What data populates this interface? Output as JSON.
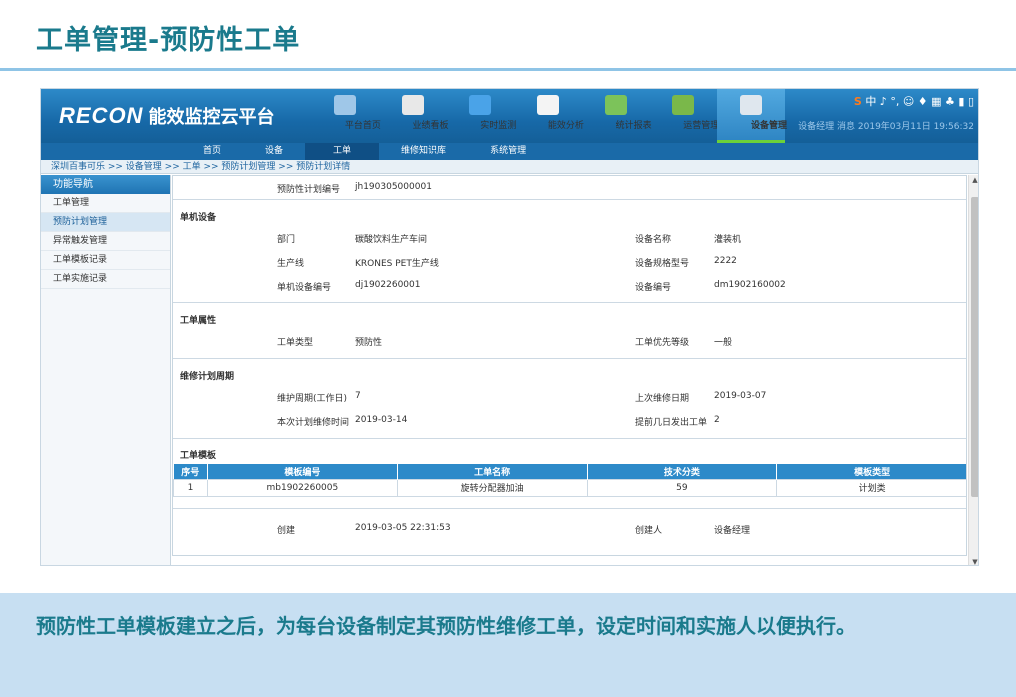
{
  "slide": {
    "title": "工单管理-预防性工单",
    "caption": "预防性工单模板建立之后，为每台设备制定其预防性维修工单，设定时间和实施人以便执行。"
  },
  "app": {
    "brand_logo": "RECON",
    "brand_name": "能效监控云平台",
    "nav": [
      {
        "label": "平台首页",
        "icon": "search-globe-icon",
        "color": "#9fc7e8"
      },
      {
        "label": "业绩看板",
        "icon": "line-chart-icon",
        "color": "#e8e8e8"
      },
      {
        "label": "实时监测",
        "icon": "monitor-icon",
        "color": "#4aa3e8"
      },
      {
        "label": "能效分析",
        "icon": "bar-chart-icon",
        "color": "#f4f4f4"
      },
      {
        "label": "统计报表",
        "icon": "report-screen-icon",
        "color": "#7cc35a"
      },
      {
        "label": "运营管理",
        "icon": "people-icon",
        "color": "#7ab84a"
      },
      {
        "label": "设备管理",
        "icon": "device-icon",
        "color": "#dfe7ee",
        "active": true
      }
    ],
    "sys_icons": "中 ♪ °, ☺ ♦ ▦ ♣ ▮ ▯",
    "user_info": "设备经理 消息 2019年03月11日 19:56:32",
    "subnav": [
      "首页",
      "设备",
      "工单",
      "维修知识库",
      "系统管理"
    ],
    "breadcrumb": "深圳百事可乐 >> 设备管理 >> 工单 >> 预防计划管理 >> 预防计划详情",
    "sidebar": {
      "heading": "功能导航",
      "items": [
        "工单管理",
        "预防计划管理",
        "异常触发管理",
        "工单模板记录",
        "工单实施记录"
      ]
    }
  },
  "detail": {
    "plan_no_label": "预防性计划编号",
    "plan_no": "jh190305000001",
    "equipment": {
      "title": "单机设备",
      "dept_label": "部门",
      "dept": "碳酸饮料生产车间",
      "name_label": "设备名称",
      "name": "灌装机",
      "line_label": "生产线",
      "line": "KRONES PET生产线",
      "model_label": "设备规格型号",
      "model": "2222",
      "unit_no_label": "单机设备编号",
      "unit_no": "dj1902260001",
      "equip_no_label": "设备编号",
      "equip_no": "dm1902160002"
    },
    "attrs": {
      "title": "工单属性",
      "type_label": "工单类型",
      "type": "预防性",
      "priority_label": "工单优先等级",
      "priority": "一般"
    },
    "cycle": {
      "title": "维修计划周期",
      "period_label": "维护周期(工作日)",
      "period": "7",
      "last_label": "上次维修日期",
      "last": "2019-03-07",
      "next_label": "本次计划维修时间",
      "next": "2019-03-14",
      "advance_label": "提前几日发出工单",
      "advance": "2"
    },
    "template": {
      "title": "工单模板",
      "headers": [
        "序号",
        "模板编号",
        "工单名称",
        "技术分类",
        "模板类型"
      ],
      "rows": [
        [
          "1",
          "mb1902260005",
          "旋转分配器加油",
          "59",
          "计划类"
        ]
      ]
    },
    "created_label": "创建",
    "created": "2019-03-05 22:31:53",
    "creator_label": "创建人",
    "creator": "设备经理"
  }
}
